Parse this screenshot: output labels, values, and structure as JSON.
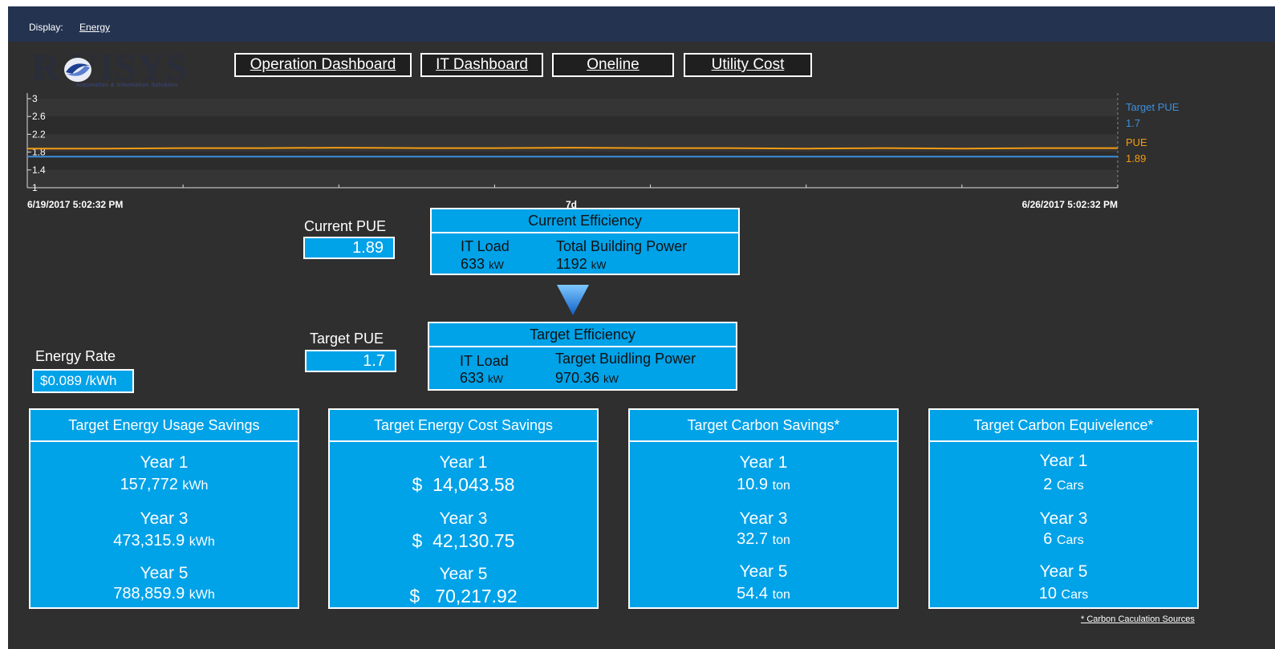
{
  "topbar": {
    "display_label": "Display:",
    "display_value": "Energy"
  },
  "logo": {
    "word": "R VISYS",
    "tagline": "Automation & Information Solutions"
  },
  "nav": [
    "Operation Dashboard",
    "IT Dashboard",
    "Oneline",
    "Utility Cost"
  ],
  "colors": {
    "accent": "#00a2e8",
    "topbar": "#233350",
    "background": "#2f2f2f",
    "pue_line": "#f39c12",
    "target_line": "#3c8fde"
  },
  "chart_data": {
    "type": "line",
    "y_ticks": [
      "3",
      "2.6",
      "2.2",
      "1.8",
      "1.4",
      "1"
    ],
    "ylim": [
      1,
      3
    ],
    "x_start_label": "6/19/2017 5:02:32 PM",
    "x_mid_label": "7d",
    "x_end_label": "6/26/2017 5:02:32 PM",
    "series": [
      {
        "name": "Target PUE",
        "current": "1.7",
        "values": [
          1.7,
          1.7,
          1.7,
          1.7,
          1.7,
          1.7,
          1.7,
          1.7,
          1.7,
          1.7,
          1.7,
          1.7,
          1.7,
          1.7,
          1.7
        ],
        "color": "#3c8fde"
      },
      {
        "name": "PUE",
        "current": "1.89",
        "values": [
          1.88,
          1.88,
          1.89,
          1.89,
          1.9,
          1.89,
          1.89,
          1.9,
          1.89,
          1.89,
          1.88,
          1.89,
          1.88,
          1.89,
          1.89
        ],
        "color": "#f39c12"
      }
    ]
  },
  "current": {
    "pue_label": "Current PUE",
    "pue_value": "1.89",
    "eff_title": "Current Efficiency",
    "it_load_label": "IT Load",
    "it_load_value": "633",
    "it_load_unit": "kW",
    "power_label": "Total Building Power",
    "power_value": "1192",
    "power_unit": "kW"
  },
  "target": {
    "pue_label": "Target PUE",
    "pue_value": "1.7",
    "eff_title": "Target Efficiency",
    "it_load_label": "IT Load",
    "it_load_value": "633",
    "it_load_unit": "kW",
    "power_label": "Target Buidling Power",
    "power_value": "970.36",
    "power_unit": "kW"
  },
  "energy_rate": {
    "label": "Energy Rate",
    "value": "$0.089 /kWh"
  },
  "savings": [
    {
      "title": "Target Energy Usage Savings",
      "rows": [
        {
          "year": "Year 1",
          "value": "157,772",
          "unit": "kWh"
        },
        {
          "year": "Year 3",
          "value": "473,315.9",
          "unit": "kWh"
        },
        {
          "year": "Year 5",
          "value": "788,859.9",
          "unit": "kWh"
        }
      ]
    },
    {
      "title": "Target Energy Cost Savings",
      "rows": [
        {
          "year": "Year 1",
          "value": "$  14,043.58",
          "unit": ""
        },
        {
          "year": "Year 3",
          "value": "$  42,130.75",
          "unit": ""
        },
        {
          "year": "Year 5",
          "value": "$   70,217.92",
          "unit": ""
        }
      ]
    },
    {
      "title": "Target Carbon Savings*",
      "rows": [
        {
          "year": "Year 1",
          "value": "10.9",
          "unit": "ton"
        },
        {
          "year": "Year 3",
          "value": "32.7",
          "unit": "ton"
        },
        {
          "year": "Year 5",
          "value": "54.4",
          "unit": "ton"
        }
      ]
    },
    {
      "title": "Target Carbon Equivelence*",
      "rows": [
        {
          "year": "Year 1",
          "value": "2",
          "unit": "Cars"
        },
        {
          "year": "Year 3",
          "value": "6",
          "unit": "Cars"
        },
        {
          "year": "Year 5",
          "value": "10",
          "unit": "Cars"
        }
      ]
    }
  ],
  "carbon_link": "* Carbon Caculation Sources"
}
